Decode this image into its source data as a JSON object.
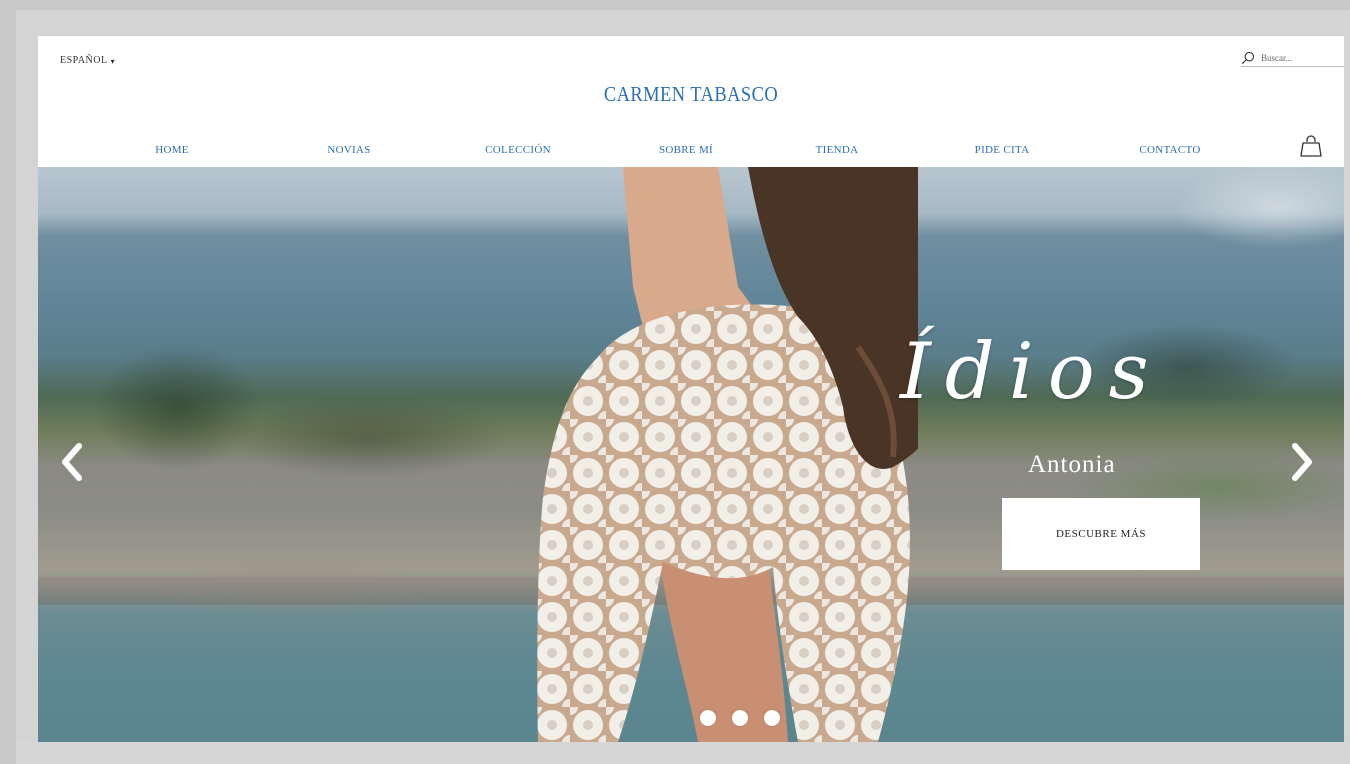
{
  "header": {
    "language_label": "ESPAÑOL",
    "search_placeholder": "Buscar...",
    "brand": "CARMEN TABASCO"
  },
  "nav": {
    "items": [
      {
        "label": "HOME"
      },
      {
        "label": "NOVIAS"
      },
      {
        "label": "COLECCIÓN"
      },
      {
        "label": "SOBRE MÍ"
      },
      {
        "label": "TIENDA"
      },
      {
        "label": "PIDE CITA"
      },
      {
        "label": "CONTACTO"
      }
    ]
  },
  "hero": {
    "title": "Ídios",
    "subtitle": "Antonia",
    "cta_label": "DESCUBRE MÁS",
    "slide_count": 3,
    "active_slide": 1
  },
  "icons": {
    "search": "search-icon",
    "bag": "shopping-bag-icon",
    "prev": "chevron-left-icon",
    "next": "chevron-right-icon",
    "language": "chevron-down-icon"
  },
  "colors": {
    "brand_blue": "#2a6fb5",
    "background": "#ffffff",
    "frame": "#c9c9c9"
  }
}
